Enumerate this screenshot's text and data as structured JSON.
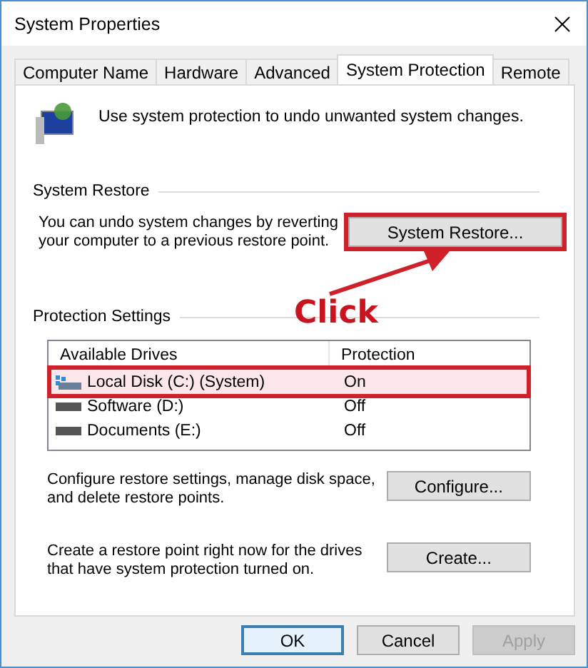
{
  "window": {
    "title": "System Properties"
  },
  "tabs": [
    {
      "label": "Computer Name",
      "selected": false
    },
    {
      "label": "Hardware",
      "selected": false
    },
    {
      "label": "Advanced",
      "selected": false
    },
    {
      "label": "System Protection",
      "selected": true
    },
    {
      "label": "Remote",
      "selected": false
    }
  ],
  "intro": "Use system protection to undo unwanted system changes.",
  "system_restore": {
    "heading": "System Restore",
    "description": "You can undo system changes by reverting your computer to a previous restore point.",
    "button": {
      "label": "System Restore...",
      "highlighted": true
    }
  },
  "annotation": {
    "label": "Click"
  },
  "protection_settings": {
    "heading": "Protection Settings",
    "columns": [
      "Available Drives",
      "Protection"
    ],
    "rows": [
      {
        "kind": "system",
        "drive": "Local Disk (C:) (System)",
        "protection": "On",
        "selected": true,
        "highlighted": true
      },
      {
        "kind": "drive",
        "drive": "Software (D:)",
        "protection": "Off",
        "selected": false,
        "highlighted": false
      },
      {
        "kind": "drive",
        "drive": "Documents (E:)",
        "protection": "Off",
        "selected": false,
        "highlighted": false
      }
    ],
    "actions": [
      {
        "description": "Configure restore settings, manage disk space, and delete restore points.",
        "button": "Configure..."
      },
      {
        "description": "Create a restore point right now for the drives that have system protection turned on.",
        "button": "Create..."
      }
    ]
  },
  "buttons": [
    {
      "label": "OK",
      "disabled": false,
      "default": true
    },
    {
      "label": "Cancel",
      "disabled": false,
      "default": false
    },
    {
      "label": "Apply",
      "disabled": true,
      "default": false
    }
  ]
}
